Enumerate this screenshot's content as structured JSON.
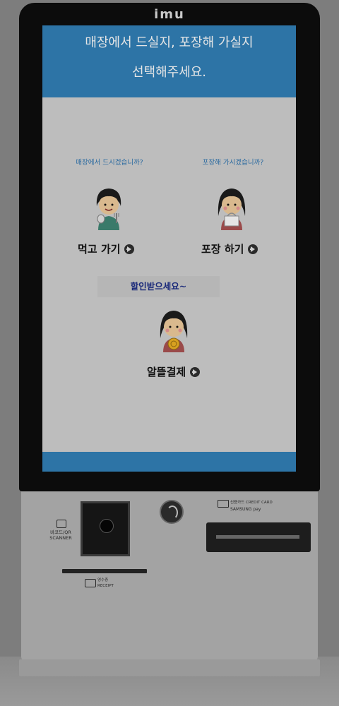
{
  "device": {
    "brand": "imu"
  },
  "screen": {
    "header": {
      "line1": "매장에서 드실지, 포장해 가실지",
      "line2": "선택해주세요."
    },
    "options": [
      {
        "question": "매장에서 드시겠습니까?",
        "label": "먹고 가기"
      },
      {
        "question": "포장해 가시겠습니까?",
        "label": "포장 하기"
      }
    ],
    "discount": {
      "banner": "할인받으세요~",
      "label": "알뜰결제"
    }
  },
  "hardware": {
    "scanner_label": "바코드/QR\nSCANNER",
    "card_label": "신용카드 CREDIT CARD",
    "card_sublabel": "SAMSUNG pay",
    "receipt_label": "영수증\nRECEIPT"
  },
  "colors": {
    "header_blue": "#2d74a6",
    "screen_bg": "#bdbdbd",
    "question_blue": "#2a6aa0",
    "banner_text": "#1b2a7a"
  }
}
